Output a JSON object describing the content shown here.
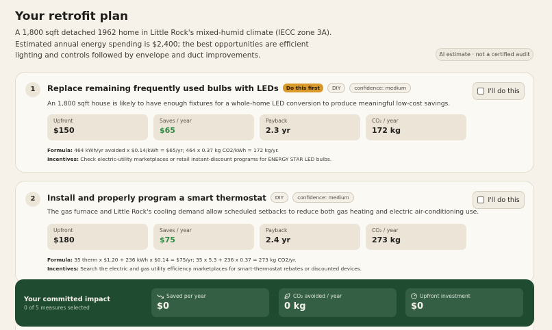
{
  "page": {
    "title": "Your retrofit plan",
    "intro": "A 1,800 sqft detached 1962 home in Little Rock's mixed-humid climate (IECC zone 3A). Estimated annual energy spending is $2,400; the best opportunities are efficient lighting and controls followed by envelope and duct improvements.",
    "ai_badge": "AI estimate · not a certified audit"
  },
  "measures": [
    {
      "number": "1",
      "title": "Replace remaining frequently used bulbs with LEDs",
      "priority_tag": "Do this first",
      "type_tag": "DIY",
      "confidence_tag": "confidence: medium",
      "description": "An 1,800 sqft house is likely to have enough fixtures for a whole-home LED conversion to produce meaningful low-cost savings.",
      "commit_label": "I'll do this",
      "stats": [
        {
          "label": "Upfront",
          "value": "$150"
        },
        {
          "label": "Saves / year",
          "value": "$65"
        },
        {
          "label": "Payback",
          "value": "2.3 yr"
        },
        {
          "label": "CO₂ / year",
          "value": "172 kg"
        }
      ],
      "formula_label": "Formula:",
      "formula": "464 kWh/yr avoided x $0.14/kWh = $65/yr; 464 x 0.37 kg CO2/kWh = 172 kg/yr.",
      "incentives_label": "Incentives:",
      "incentives": "Check electric-utility marketplaces or retail instant-discount programs for ENERGY STAR LED bulbs."
    },
    {
      "number": "2",
      "title": "Install and properly program a smart thermostat",
      "type_tag": "DIY",
      "confidence_tag": "confidence: medium",
      "description": "The gas furnace and Little Rock's cooling demand allow scheduled setbacks to reduce both gas heating and electric air-conditioning use.",
      "commit_label": "I'll do this",
      "stats": [
        {
          "label": "Upfront",
          "value": "$180"
        },
        {
          "label": "Saves / year",
          "value": "$75"
        },
        {
          "label": "Payback",
          "value": "2.4 yr"
        },
        {
          "label": "CO₂ / year",
          "value": "273 kg"
        }
      ],
      "formula_label": "Formula:",
      "formula": "35 therm x $1.20 + 236 kWh x $0.14 = $75/yr; 35 x 5.3 + 236 x 0.37 = 273 kg CO2/yr.",
      "incentives_label": "Incentives:",
      "incentives": "Search the electric and gas utility efficiency marketplaces for smart-thermostat rebates or discounted devices."
    }
  ],
  "impact": {
    "title": "Your committed impact",
    "subtitle": "0 of 5 measures selected",
    "tiles": [
      {
        "label": "Saved per year",
        "value": "$0",
        "icon": "trend-down-icon"
      },
      {
        "label": "CO₂ avoided / year",
        "value": "0 kg",
        "icon": "leaf-icon"
      },
      {
        "label": "Upfront investment",
        "value": "$0",
        "icon": "gauge-icon"
      }
    ]
  },
  "colors": {
    "background": "#f6f2ea",
    "card": "#fbf9f4",
    "priority_tag": "#d99a2b",
    "savings_green": "#2f8a43",
    "impact_bar": "#1f4b31"
  }
}
